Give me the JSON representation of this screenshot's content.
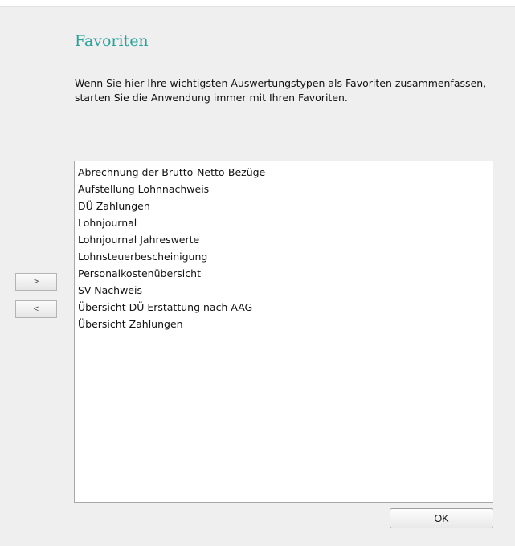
{
  "dialog": {
    "title": "Favoriten",
    "description": "Wenn Sie hier Ihre wichtigsten Auswertungstypen als Favoriten zusammenfassen, starten Sie die Anwendung immer mit Ihren Favoriten."
  },
  "transfer_buttons": {
    "add_label": ">",
    "remove_label": "<"
  },
  "list": {
    "items": [
      "Abrechnung der Brutto-Netto-Bezüge",
      "Aufstellung Lohnnachweis",
      "DÜ Zahlungen",
      "Lohnjournal",
      "Lohnjournal Jahreswerte",
      "Lohnsteuerbescheinigung",
      "Personalkostenübersicht",
      "SV-Nachweis",
      "Übersicht DÜ Erstattung nach AAG",
      "Übersicht Zahlungen"
    ]
  },
  "footer": {
    "ok_label": "OK"
  },
  "colors": {
    "title": "#2aa39a",
    "background": "#efefef",
    "list_background": "#ffffff"
  }
}
